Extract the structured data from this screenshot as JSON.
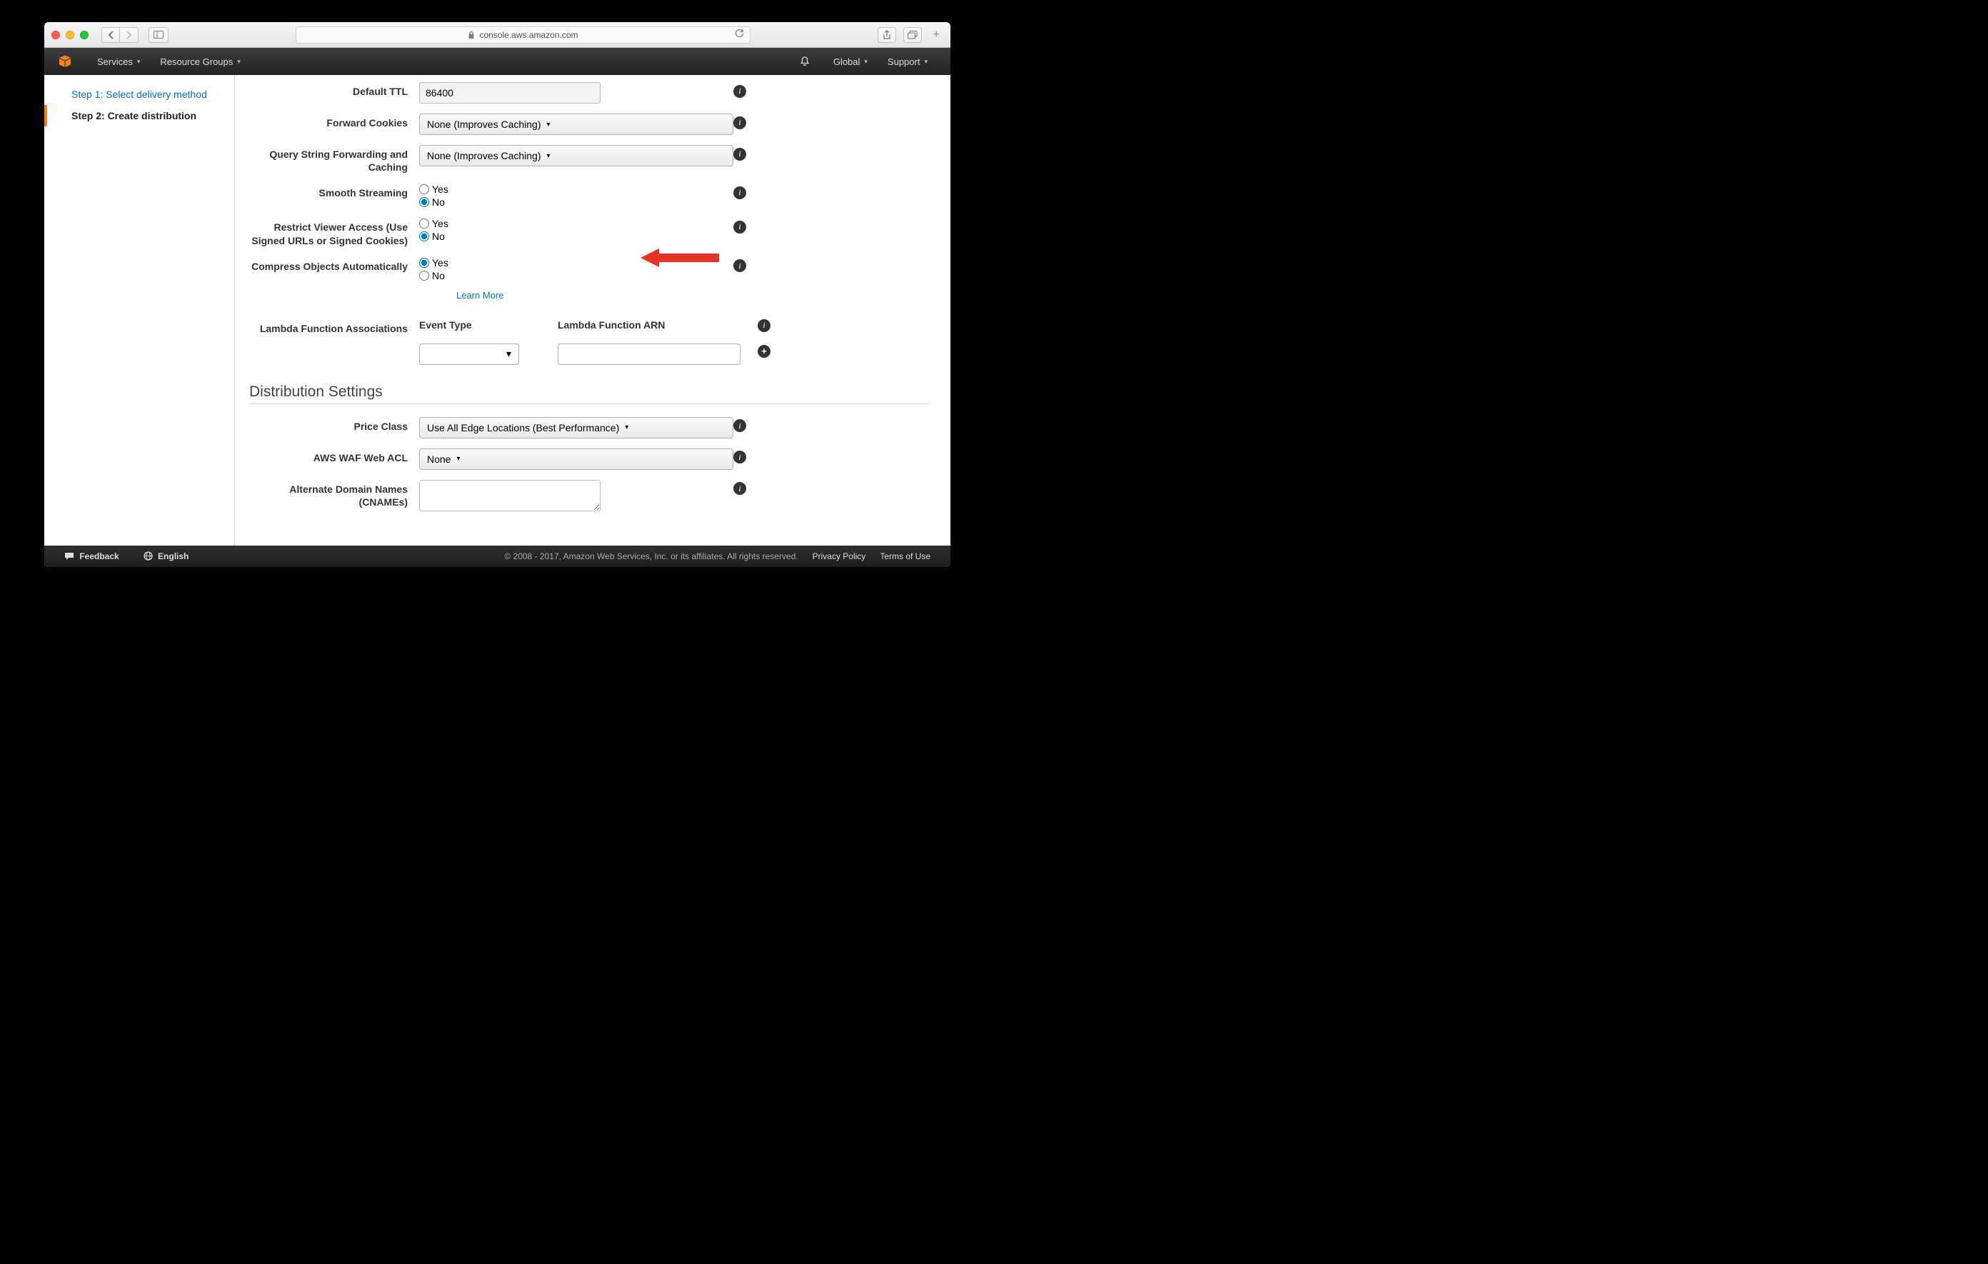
{
  "browser": {
    "url_host": "console.aws.amazon.com"
  },
  "aws_header": {
    "services": "Services",
    "resource_groups": "Resource Groups",
    "region": "Global",
    "support": "Support"
  },
  "nav": {
    "step1": "Step 1: Select delivery method",
    "step2": "Step 2: Create distribution"
  },
  "form": {
    "default_ttl": {
      "label": "Default TTL",
      "value": "86400"
    },
    "forward_cookies": {
      "label": "Forward Cookies",
      "value": "None (Improves Caching)"
    },
    "query_string": {
      "label": "Query String Forwarding and Caching",
      "value": "None (Improves Caching)"
    },
    "smooth_streaming": {
      "label": "Smooth Streaming",
      "yes": "Yes",
      "no": "No"
    },
    "restrict_viewer": {
      "label": "Restrict Viewer Access (Use Signed URLs or Signed Cookies)",
      "yes": "Yes",
      "no": "No"
    },
    "compress": {
      "label": "Compress Objects Automatically",
      "yes": "Yes",
      "no": "No",
      "learn_more": "Learn More"
    },
    "lambda": {
      "label": "Lambda Function Associations",
      "event_type": "Event Type",
      "arn": "Lambda Function ARN"
    },
    "distribution_settings": "Distribution Settings",
    "price_class": {
      "label": "Price Class",
      "value": "Use All Edge Locations (Best Performance)"
    },
    "waf": {
      "label": "AWS WAF Web ACL",
      "value": "None"
    },
    "cnames": {
      "label": "Alternate Domain Names (CNAMEs)"
    }
  },
  "footer": {
    "feedback": "Feedback",
    "english": "English",
    "copyright": "© 2008 - 2017, Amazon Web Services, Inc. or its affiliates. All rights reserved.",
    "privacy": "Privacy Policy",
    "terms": "Terms of Use"
  }
}
